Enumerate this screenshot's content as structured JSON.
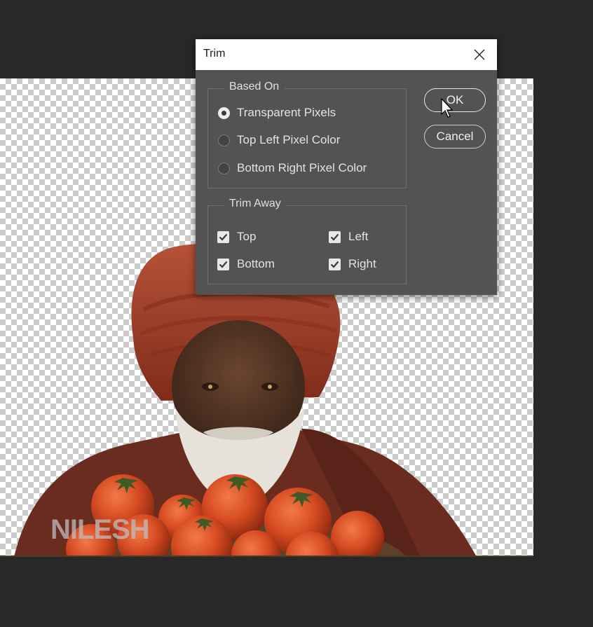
{
  "dialog": {
    "title": "Trim",
    "based_on": {
      "label": "Based On",
      "options": [
        {
          "label": "Transparent Pixels",
          "selected": true
        },
        {
          "label": "Top Left Pixel Color",
          "selected": false
        },
        {
          "label": "Bottom Right Pixel Color",
          "selected": false
        }
      ]
    },
    "trim_away": {
      "label": "Trim Away",
      "checkboxes": [
        {
          "label": "Top",
          "checked": true
        },
        {
          "label": "Left",
          "checked": true
        },
        {
          "label": "Bottom",
          "checked": true
        },
        {
          "label": "Right",
          "checked": true
        }
      ]
    },
    "buttons": {
      "ok": "OK",
      "cancel": "Cancel"
    }
  },
  "canvas": {
    "watermark": "NILESH"
  },
  "colors": {
    "workspace": "#282828",
    "dialog_bg": "#535353",
    "titlebar_bg": "#ffffff",
    "accent_turban": "#a8452e"
  },
  "icons": [
    "close-icon",
    "checkmark-icon",
    "mouse-cursor-icon"
  ]
}
